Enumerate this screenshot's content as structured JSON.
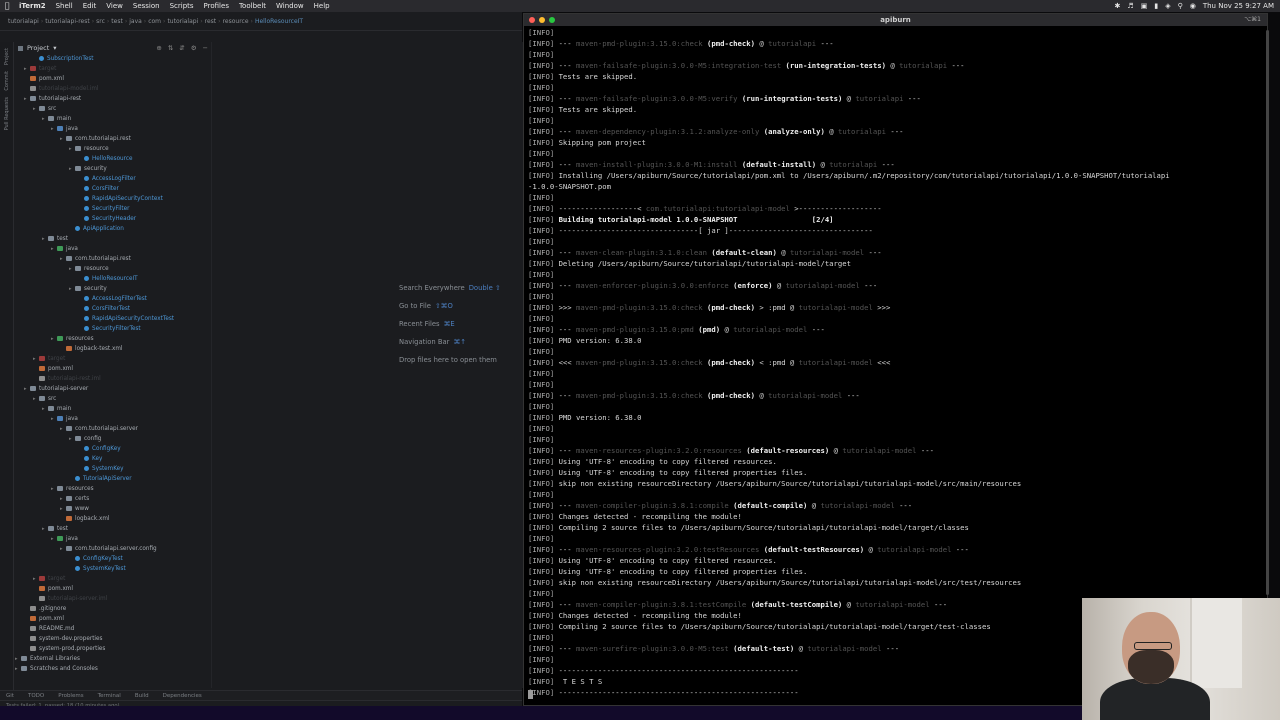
{
  "menubar": {
    "items": [
      "iTerm2",
      "Shell",
      "Edit",
      "View",
      "Session",
      "Scripts",
      "Profiles",
      "Toolbelt",
      "Window",
      "Help"
    ],
    "clock": "Thu Nov 25 9:27 AM"
  },
  "ide": {
    "breadcrumb": [
      "tutorialapi",
      "tutorialapi-rest",
      "src",
      "test",
      "java",
      "com",
      "tutorialapi",
      "rest",
      "resource",
      "HelloResourceIT"
    ],
    "project_label": "Project",
    "tree": [
      {
        "t": "SubscriptionTest",
        "i": 1,
        "k": "java cls"
      },
      {
        "t": "target",
        "i": 0,
        "k": "red dim"
      },
      {
        "t": "pom.xml",
        "i": 0,
        "k": "xml"
      },
      {
        "t": "tutorialapi-model.iml",
        "i": 0,
        "k": "file dim"
      },
      {
        "t": "tutorialapi-rest",
        "i": 0,
        "k": "folder"
      },
      {
        "t": "src",
        "i": 1,
        "k": "folder"
      },
      {
        "t": "main",
        "i": 2,
        "k": "folder"
      },
      {
        "t": "java",
        "i": 3,
        "k": "src"
      },
      {
        "t": "com.tutorialapi.rest",
        "i": 4,
        "k": "folder"
      },
      {
        "t": "resource",
        "i": 5,
        "k": "folder"
      },
      {
        "t": "HelloResource",
        "i": 6,
        "k": "java cls"
      },
      {
        "t": "security",
        "i": 5,
        "k": "folder"
      },
      {
        "t": "AccessLogFilter",
        "i": 6,
        "k": "java cls"
      },
      {
        "t": "CorsFilter",
        "i": 6,
        "k": "java cls"
      },
      {
        "t": "RapidApiSecurityContext",
        "i": 6,
        "k": "java cls"
      },
      {
        "t": "SecurityFilter",
        "i": 6,
        "k": "java cls"
      },
      {
        "t": "SecurityHeader",
        "i": 6,
        "k": "java cls"
      },
      {
        "t": "ApiApplication",
        "i": 5,
        "k": "java cls"
      },
      {
        "t": "test",
        "i": 2,
        "k": "folder"
      },
      {
        "t": "java",
        "i": 3,
        "k": "test"
      },
      {
        "t": "com.tutorialapi.rest",
        "i": 4,
        "k": "folder"
      },
      {
        "t": "resource",
        "i": 5,
        "k": "folder"
      },
      {
        "t": "HelloResourceIT",
        "i": 6,
        "k": "java cls"
      },
      {
        "t": "security",
        "i": 5,
        "k": "folder"
      },
      {
        "t": "AccessLogFilterTest",
        "i": 6,
        "k": "java cls"
      },
      {
        "t": "CorsFilterTest",
        "i": 6,
        "k": "java cls"
      },
      {
        "t": "RapidApiSecurityContextTest",
        "i": 6,
        "k": "java cls"
      },
      {
        "t": "SecurityFilterTest",
        "i": 6,
        "k": "java cls"
      },
      {
        "t": "resources",
        "i": 3,
        "k": "test"
      },
      {
        "t": "logback-test.xml",
        "i": 4,
        "k": "xml"
      },
      {
        "t": "target",
        "i": 1,
        "k": "red dim"
      },
      {
        "t": "pom.xml",
        "i": 1,
        "k": "xml"
      },
      {
        "t": "tutorialapi-rest.iml",
        "i": 1,
        "k": "file dim"
      },
      {
        "t": "tutorialapi-server",
        "i": 0,
        "k": "folder"
      },
      {
        "t": "src",
        "i": 1,
        "k": "folder"
      },
      {
        "t": "main",
        "i": 2,
        "k": "folder"
      },
      {
        "t": "java",
        "i": 3,
        "k": "src"
      },
      {
        "t": "com.tutorialapi.server",
        "i": 4,
        "k": "folder"
      },
      {
        "t": "config",
        "i": 5,
        "k": "folder"
      },
      {
        "t": "ConfigKey",
        "i": 6,
        "k": "java cls"
      },
      {
        "t": "Key",
        "i": 6,
        "k": "java cls"
      },
      {
        "t": "SystemKey",
        "i": 6,
        "k": "java cls"
      },
      {
        "t": "TutorialApiServer",
        "i": 5,
        "k": "java cls"
      },
      {
        "t": "resources",
        "i": 3,
        "k": "folder"
      },
      {
        "t": "certs",
        "i": 4,
        "k": "folder"
      },
      {
        "t": "www",
        "i": 4,
        "k": "folder"
      },
      {
        "t": "logback.xml",
        "i": 4,
        "k": "xml"
      },
      {
        "t": "test",
        "i": 2,
        "k": "folder"
      },
      {
        "t": "java",
        "i": 3,
        "k": "test"
      },
      {
        "t": "com.tutorialapi.server.config",
        "i": 4,
        "k": "folder"
      },
      {
        "t": "ConfigKeyTest",
        "i": 5,
        "k": "java cls"
      },
      {
        "t": "SystemKeyTest",
        "i": 5,
        "k": "java cls"
      },
      {
        "t": "target",
        "i": 1,
        "k": "red dim"
      },
      {
        "t": "pom.xml",
        "i": 1,
        "k": "xml"
      },
      {
        "t": "tutorialapi-server.iml",
        "i": 1,
        "k": "file dim"
      },
      {
        "t": ".gitignore",
        "i": 0,
        "k": "file"
      },
      {
        "t": "pom.xml",
        "i": 0,
        "k": "xml"
      },
      {
        "t": "README.md",
        "i": 0,
        "k": "file"
      },
      {
        "t": "system-dev.properties",
        "i": 0,
        "k": "file"
      },
      {
        "t": "system-prod.properties",
        "i": 0,
        "k": "file"
      },
      {
        "t": "External Libraries",
        "i": -1,
        "k": "folder"
      },
      {
        "t": "Scratches and Consoles",
        "i": -1,
        "k": "folder"
      }
    ],
    "hints": [
      {
        "label": "Search Everywhere",
        "key": "Double ⇧"
      },
      {
        "label": "Go to File",
        "key": "⇧⌘O"
      },
      {
        "label": "Recent Files",
        "key": "⌘E"
      },
      {
        "label": "Navigation Bar",
        "key": "⌘↑"
      },
      {
        "label": "Drop files here to open them",
        "key": ""
      }
    ],
    "bottom_tabs": [
      "Git",
      "TODO",
      "Problems",
      "Terminal",
      "Build",
      "Dependencies"
    ],
    "status": "Tests failed: 1, passed: 18 (10 minutes ago)"
  },
  "terminal": {
    "title": "apiburn",
    "tab_shortcut": "⌥⌘1",
    "lines": [
      {
        "p": "[INFO] ",
        "c": []
      },
      {
        "p": "[INFO] ",
        "c": [
          [
            "--- ",
            "n"
          ],
          [
            "maven-pmd-plugin:3.15.0:check",
            "g"
          ],
          [
            " (pmd-check)",
            "b"
          ],
          [
            " @ ",
            "n"
          ],
          [
            "tutorialapi",
            "g"
          ],
          [
            " ---",
            "n"
          ]
        ]
      },
      {
        "p": "[INFO] ",
        "c": []
      },
      {
        "p": "[INFO] ",
        "c": [
          [
            "--- ",
            "n"
          ],
          [
            "maven-failsafe-plugin:3.0.0-M5:integration-test",
            "g"
          ],
          [
            " (run-integration-tests)",
            "b"
          ],
          [
            " @ ",
            "n"
          ],
          [
            "tutorialapi",
            "g"
          ],
          [
            " ---",
            "n"
          ]
        ]
      },
      {
        "p": "[INFO] ",
        "c": [
          [
            "Tests are skipped.",
            "n"
          ]
        ]
      },
      {
        "p": "[INFO] ",
        "c": []
      },
      {
        "p": "[INFO] ",
        "c": [
          [
            "--- ",
            "n"
          ],
          [
            "maven-failsafe-plugin:3.0.0-M5:verify",
            "g"
          ],
          [
            " (run-integration-tests)",
            "b"
          ],
          [
            " @ ",
            "n"
          ],
          [
            "tutorialapi",
            "g"
          ],
          [
            " ---",
            "n"
          ]
        ]
      },
      {
        "p": "[INFO] ",
        "c": [
          [
            "Tests are skipped.",
            "n"
          ]
        ]
      },
      {
        "p": "[INFO] ",
        "c": []
      },
      {
        "p": "[INFO] ",
        "c": [
          [
            "--- ",
            "n"
          ],
          [
            "maven-dependency-plugin:3.1.2:analyze-only",
            "g"
          ],
          [
            " (analyze-only)",
            "b"
          ],
          [
            " @ ",
            "n"
          ],
          [
            "tutorialapi",
            "g"
          ],
          [
            " ---",
            "n"
          ]
        ]
      },
      {
        "p": "[INFO] ",
        "c": [
          [
            "Skipping pom project",
            "n"
          ]
        ]
      },
      {
        "p": "[INFO] ",
        "c": []
      },
      {
        "p": "[INFO] ",
        "c": [
          [
            "--- ",
            "n"
          ],
          [
            "maven-install-plugin:3.0.0-M1:install",
            "g"
          ],
          [
            " (default-install)",
            "b"
          ],
          [
            " @ ",
            "n"
          ],
          [
            "tutorialapi",
            "g"
          ],
          [
            " ---",
            "n"
          ]
        ]
      },
      {
        "p": "[INFO] ",
        "c": [
          [
            "Installing /Users/apiburn/Source/tutorialapi/pom.xml to /Users/apiburn/.m2/repository/com/tutorialapi/tutorialapi/1.0.0-SNAPSHOT/tutorialapi",
            "n"
          ]
        ]
      },
      {
        "p": "",
        "c": [
          [
            "-1.0.0-SNAPSHOT.pom",
            "n"
          ]
        ]
      },
      {
        "p": "[INFO] ",
        "c": []
      },
      {
        "p": "[INFO] ",
        "c": [
          [
            "------------------< ",
            "n"
          ],
          [
            "com.tutorialapi:tutorialapi-model",
            "g"
          ],
          [
            " >-------------------",
            "n"
          ]
        ]
      },
      {
        "p": "[INFO] ",
        "c": [
          [
            "Building tutorialapi-model 1.0.0-SNAPSHOT                 [2/4]",
            "b"
          ]
        ]
      },
      {
        "p": "[INFO] ",
        "c": [
          [
            "--------------------------------[ jar ]---------------------------------",
            "n"
          ]
        ]
      },
      {
        "p": "[INFO] ",
        "c": []
      },
      {
        "p": "[INFO] ",
        "c": [
          [
            "--- ",
            "n"
          ],
          [
            "maven-clean-plugin:3.1.0:clean",
            "g"
          ],
          [
            " (default-clean)",
            "b"
          ],
          [
            " @ ",
            "n"
          ],
          [
            "tutorialapi-model",
            "g"
          ],
          [
            " ---",
            "n"
          ]
        ]
      },
      {
        "p": "[INFO] ",
        "c": [
          [
            "Deleting /Users/apiburn/Source/tutorialapi/tutorialapi-model/target",
            "n"
          ]
        ]
      },
      {
        "p": "[INFO] ",
        "c": []
      },
      {
        "p": "[INFO] ",
        "c": [
          [
            "--- ",
            "n"
          ],
          [
            "maven-enforcer-plugin:3.0.0:enforce",
            "g"
          ],
          [
            " (enforce)",
            "b"
          ],
          [
            " @ ",
            "n"
          ],
          [
            "tutorialapi-model",
            "g"
          ],
          [
            " ---",
            "n"
          ]
        ]
      },
      {
        "p": "[INFO] ",
        "c": []
      },
      {
        "p": "[INFO] ",
        "c": [
          [
            ">>> ",
            "n"
          ],
          [
            "maven-pmd-plugin:3.15.0:check",
            "g"
          ],
          [
            " (pmd-check)",
            "b"
          ],
          [
            " > :pmd @ ",
            "n"
          ],
          [
            "tutorialapi-model",
            "g"
          ],
          [
            " >>>",
            "n"
          ]
        ]
      },
      {
        "p": "[INFO] ",
        "c": []
      },
      {
        "p": "[INFO] ",
        "c": [
          [
            "--- ",
            "n"
          ],
          [
            "maven-pmd-plugin:3.15.0:pmd",
            "g"
          ],
          [
            " (pmd)",
            "b"
          ],
          [
            " @ ",
            "n"
          ],
          [
            "tutorialapi-model",
            "g"
          ],
          [
            " ---",
            "n"
          ]
        ]
      },
      {
        "p": "[INFO] ",
        "c": [
          [
            "PMD version: 6.38.0",
            "n"
          ]
        ]
      },
      {
        "p": "[INFO] ",
        "c": []
      },
      {
        "p": "[INFO] ",
        "c": [
          [
            "<<< ",
            "n"
          ],
          [
            "maven-pmd-plugin:3.15.0:check",
            "g"
          ],
          [
            " (pmd-check)",
            "b"
          ],
          [
            " < :pmd @ ",
            "n"
          ],
          [
            "tutorialapi-model",
            "g"
          ],
          [
            " <<<",
            "n"
          ]
        ]
      },
      {
        "p": "[INFO] ",
        "c": []
      },
      {
        "p": "[INFO] ",
        "c": []
      },
      {
        "p": "[INFO] ",
        "c": [
          [
            "--- ",
            "n"
          ],
          [
            "maven-pmd-plugin:3.15.0:check",
            "g"
          ],
          [
            " (pmd-check)",
            "b"
          ],
          [
            " @ ",
            "n"
          ],
          [
            "tutorialapi-model",
            "g"
          ],
          [
            " ---",
            "n"
          ]
        ]
      },
      {
        "p": "[INFO] ",
        "c": []
      },
      {
        "p": "[INFO] ",
        "c": [
          [
            "PMD version: 6.38.0",
            "n"
          ]
        ]
      },
      {
        "p": "[INFO] ",
        "c": []
      },
      {
        "p": "[INFO] ",
        "c": []
      },
      {
        "p": "[INFO] ",
        "c": [
          [
            "--- ",
            "n"
          ],
          [
            "maven-resources-plugin:3.2.0:resources",
            "g"
          ],
          [
            " (default-resources)",
            "b"
          ],
          [
            " @ ",
            "n"
          ],
          [
            "tutorialapi-model",
            "g"
          ],
          [
            " ---",
            "n"
          ]
        ]
      },
      {
        "p": "[INFO] ",
        "c": [
          [
            "Using 'UTF-8' encoding to copy filtered resources.",
            "n"
          ]
        ]
      },
      {
        "p": "[INFO] ",
        "c": [
          [
            "Using 'UTF-8' encoding to copy filtered properties files.",
            "n"
          ]
        ]
      },
      {
        "p": "[INFO] ",
        "c": [
          [
            "skip non existing resourceDirectory /Users/apiburn/Source/tutorialapi/tutorialapi-model/src/main/resources",
            "n"
          ]
        ]
      },
      {
        "p": "[INFO] ",
        "c": []
      },
      {
        "p": "[INFO] ",
        "c": [
          [
            "--- ",
            "n"
          ],
          [
            "maven-compiler-plugin:3.8.1:compile",
            "g"
          ],
          [
            " (default-compile)",
            "b"
          ],
          [
            " @ ",
            "n"
          ],
          [
            "tutorialapi-model",
            "g"
          ],
          [
            " ---",
            "n"
          ]
        ]
      },
      {
        "p": "[INFO] ",
        "c": [
          [
            "Changes detected - recompiling the module!",
            "n"
          ]
        ]
      },
      {
        "p": "[INFO] ",
        "c": [
          [
            "Compiling 2 source files to /Users/apiburn/Source/tutorialapi/tutorialapi-model/target/classes",
            "n"
          ]
        ]
      },
      {
        "p": "[INFO] ",
        "c": []
      },
      {
        "p": "[INFO] ",
        "c": [
          [
            "--- ",
            "n"
          ],
          [
            "maven-resources-plugin:3.2.0:testResources",
            "g"
          ],
          [
            " (default-testResources)",
            "b"
          ],
          [
            " @ ",
            "n"
          ],
          [
            "tutorialapi-model",
            "g"
          ],
          [
            " ---",
            "n"
          ]
        ]
      },
      {
        "p": "[INFO] ",
        "c": [
          [
            "Using 'UTF-8' encoding to copy filtered resources.",
            "n"
          ]
        ]
      },
      {
        "p": "[INFO] ",
        "c": [
          [
            "Using 'UTF-8' encoding to copy filtered properties files.",
            "n"
          ]
        ]
      },
      {
        "p": "[INFO] ",
        "c": [
          [
            "skip non existing resourceDirectory /Users/apiburn/Source/tutorialapi/tutorialapi-model/src/test/resources",
            "n"
          ]
        ]
      },
      {
        "p": "[INFO] ",
        "c": []
      },
      {
        "p": "[INFO] ",
        "c": [
          [
            "--- ",
            "n"
          ],
          [
            "maven-compiler-plugin:3.8.1:testCompile",
            "g"
          ],
          [
            " (default-testCompile)",
            "b"
          ],
          [
            " @ ",
            "n"
          ],
          [
            "tutorialapi-model",
            "g"
          ],
          [
            " ---",
            "n"
          ]
        ]
      },
      {
        "p": "[INFO] ",
        "c": [
          [
            "Changes detected - recompiling the module!",
            "n"
          ]
        ]
      },
      {
        "p": "[INFO] ",
        "c": [
          [
            "Compiling 2 source files to /Users/apiburn/Source/tutorialapi/tutorialapi-model/target/test-classes",
            "n"
          ]
        ]
      },
      {
        "p": "[INFO] ",
        "c": []
      },
      {
        "p": "[INFO] ",
        "c": [
          [
            "--- ",
            "n"
          ],
          [
            "maven-surefire-plugin:3.0.0-M5:test",
            "g"
          ],
          [
            " (default-test)",
            "b"
          ],
          [
            " @ ",
            "n"
          ],
          [
            "tutorialapi-model",
            "g"
          ],
          [
            " ---",
            "n"
          ]
        ]
      },
      {
        "p": "[INFO] ",
        "c": []
      },
      {
        "p": "[INFO] ",
        "c": [
          [
            "-------------------------------------------------------",
            "n"
          ]
        ]
      },
      {
        "p": "[INFO] ",
        "c": [
          [
            " T E S T S",
            "n"
          ]
        ]
      },
      {
        "p": "[INFO] ",
        "c": [
          [
            "-------------------------------------------------------",
            "n"
          ]
        ]
      }
    ]
  },
  "colors": {
    "accent_blue": "#4d97d6",
    "plugin_gray": "#555555",
    "terminal_bg": "#000000",
    "ide_bg": "#1b1c1f"
  }
}
